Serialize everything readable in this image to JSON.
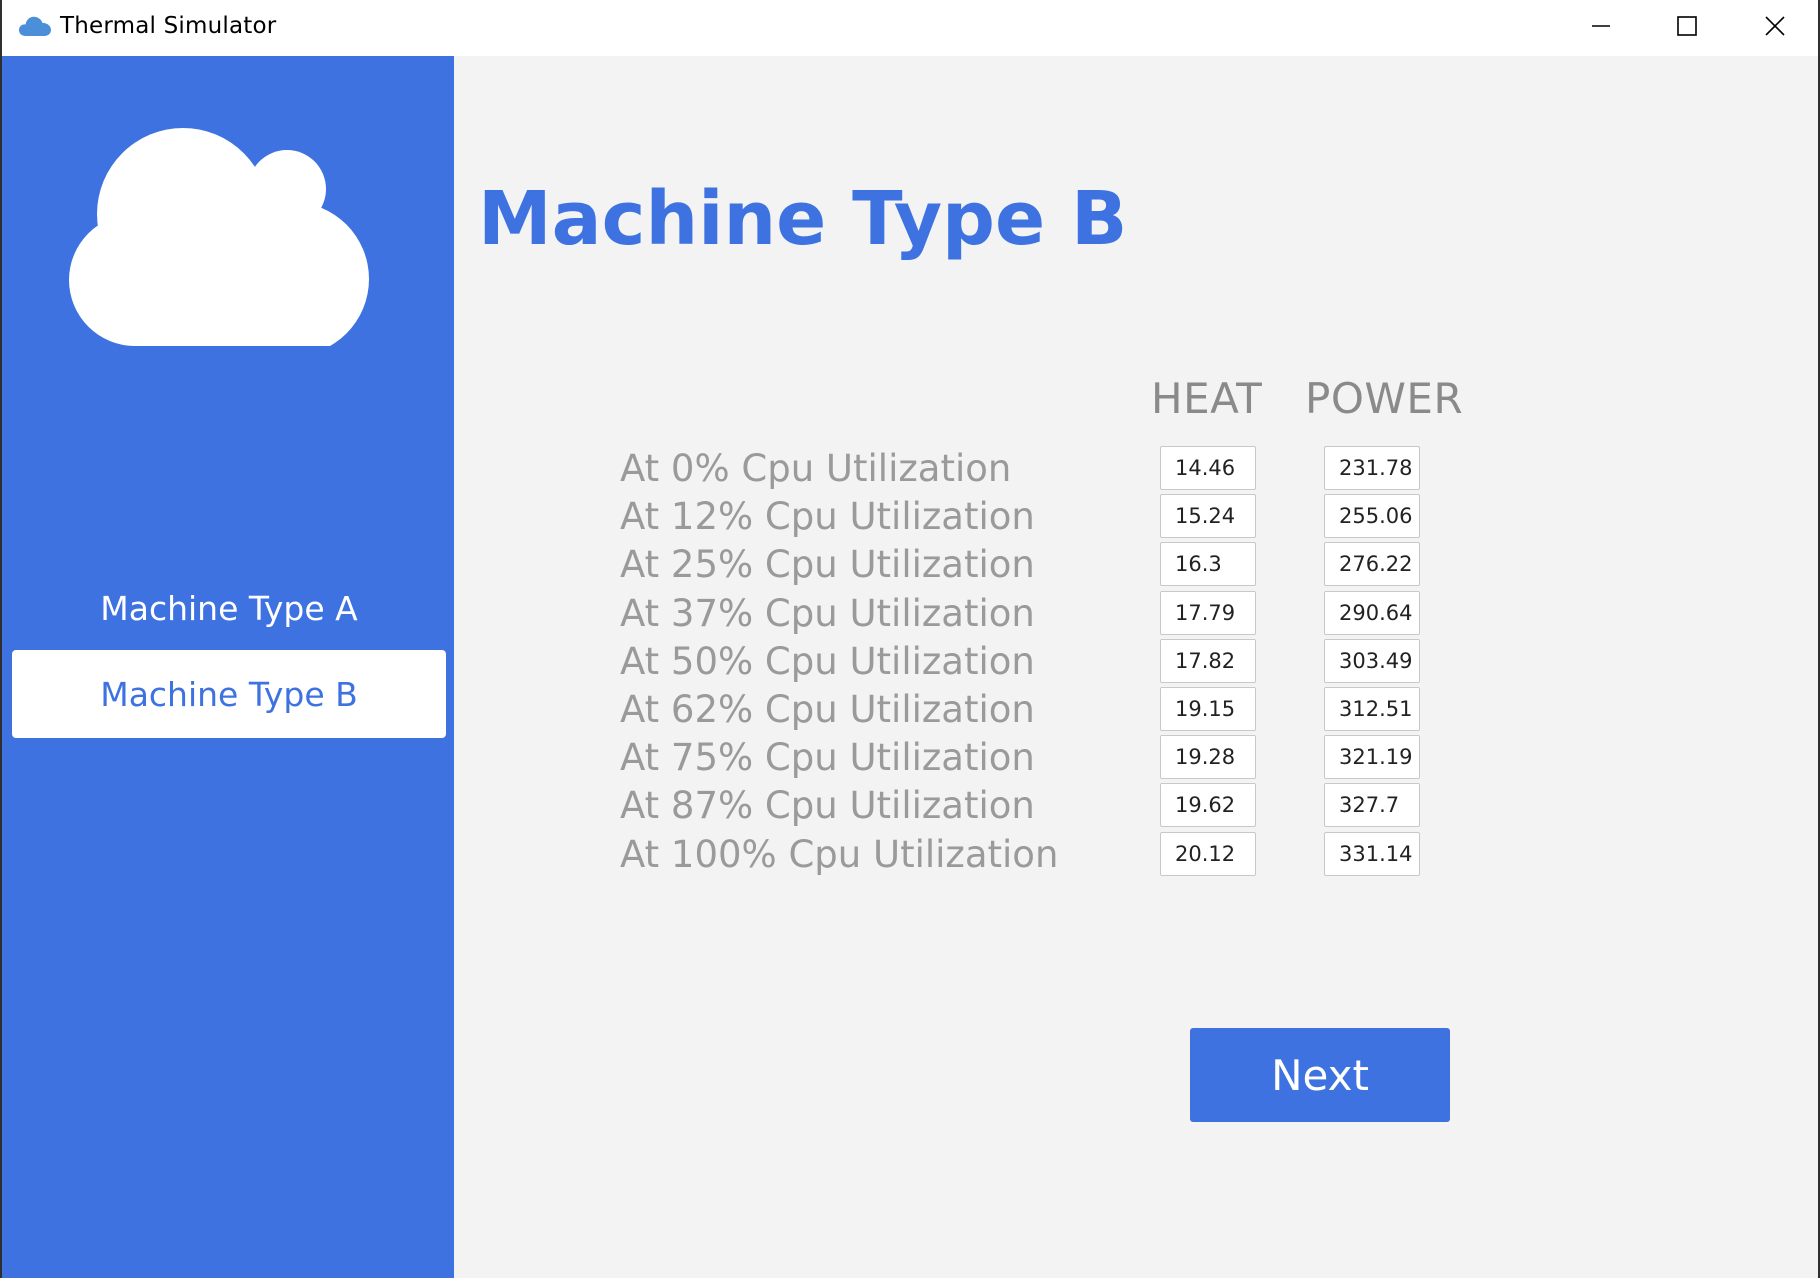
{
  "window": {
    "title": "Thermal Simulator",
    "app_icon": "cloud-icon"
  },
  "sidebar": {
    "logo": "cloud-icon",
    "items": [
      {
        "label": "Machine Type A",
        "selected": false
      },
      {
        "label": "Machine Type B",
        "selected": true
      }
    ]
  },
  "main": {
    "title": "Machine Type B",
    "columns": [
      "HEAT",
      "POWER"
    ],
    "rows": [
      {
        "label": "At 0% Cpu Utilization",
        "heat": "14.46",
        "power": "231.78"
      },
      {
        "label": "At 12% Cpu Utilization",
        "heat": "15.24",
        "power": "255.06"
      },
      {
        "label": "At 25% Cpu Utilization",
        "heat": "16.3",
        "power": "276.22"
      },
      {
        "label": "At 37% Cpu Utilization",
        "heat": "17.79",
        "power": "290.64"
      },
      {
        "label": "At 50% Cpu Utilization",
        "heat": "17.82",
        "power": "303.49"
      },
      {
        "label": "At 62% Cpu Utilization",
        "heat": "19.15",
        "power": "312.51"
      },
      {
        "label": "At 75% Cpu Utilization",
        "heat": "19.28",
        "power": "321.19"
      },
      {
        "label": "At 87% Cpu Utilization",
        "heat": "19.62",
        "power": "327.7"
      },
      {
        "label": "At 100% Cpu Utilization",
        "heat": "20.12",
        "power": "331.14"
      }
    ],
    "next_label": "Next"
  },
  "colors": {
    "accent": "#3d72e0",
    "background": "#f3f3f3",
    "label_gray": "#9a9a9a"
  }
}
